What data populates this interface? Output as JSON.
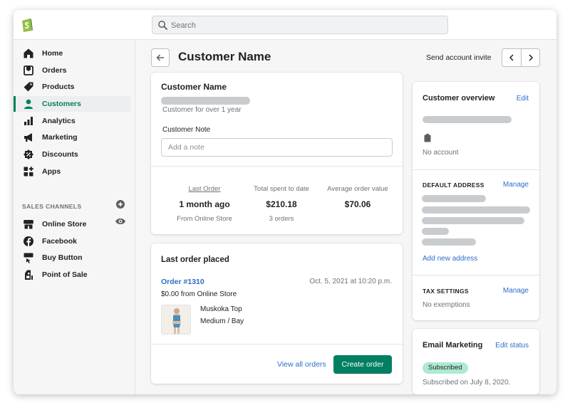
{
  "search": {
    "placeholder": "Search"
  },
  "nav": {
    "items": [
      {
        "label": "Home",
        "icon": "home-icon"
      },
      {
        "label": "Orders",
        "icon": "orders-icon"
      },
      {
        "label": "Products",
        "icon": "tag-icon"
      },
      {
        "label": "Customers",
        "icon": "person-icon",
        "active": true
      },
      {
        "label": "Analytics",
        "icon": "bar-chart-icon"
      },
      {
        "label": "Marketing",
        "icon": "megaphone-icon"
      },
      {
        "label": "Discounts",
        "icon": "discount-icon"
      },
      {
        "label": "Apps",
        "icon": "apps-icon"
      }
    ],
    "sales_channels_label": "SALES CHANNELS",
    "channels": [
      {
        "label": "Online Store",
        "icon": "store-icon"
      },
      {
        "label": "Facebook",
        "icon": "facebook-icon"
      },
      {
        "label": "Buy Button",
        "icon": "buy-button-icon"
      },
      {
        "label": "Point of Sale",
        "icon": "point-of-sale-icon"
      }
    ]
  },
  "page": {
    "title": "Customer Name",
    "send_invite": "Send account invite"
  },
  "customer_card": {
    "title": "Customer Name",
    "since": "Customer for over 1 year",
    "note_label": "Customer Note",
    "note_placeholder": "Add a note",
    "stats": {
      "last_order_label": "Last Order",
      "last_order_value": "1 month ago",
      "last_order_sub": "From Online Store",
      "total_spent_label": "Total spent to date",
      "total_spent_value": "$210.18",
      "total_spent_sub": "3 orders",
      "avg_order_label": "Average order value",
      "avg_order_value": "$70.06"
    }
  },
  "last_order": {
    "title": "Last order placed",
    "order_number": "Order #1310",
    "date": "Oct. 5, 2021 at 10:20 p.m.",
    "amount_source": "$0.00 from Online Store",
    "product_name": "Muskoka Top",
    "product_variant": "Medium / Bay",
    "view_all": "View all orders",
    "create_order": "Create order"
  },
  "overview": {
    "title": "Customer overview",
    "edit": "Edit",
    "no_account": "No account",
    "default_address_label": "DEFAULT ADDRESS",
    "manage": "Manage",
    "add_address": "Add new address",
    "tax_label": "TAX SETTINGS",
    "tax_manage": "Manage",
    "tax_value": "No exemptions"
  },
  "email_marketing": {
    "title": "Email Marketing",
    "edit_status": "Edit status",
    "badge": "Subscribed",
    "subscribed_on": "Subscribed on July 8, 2020."
  },
  "colors": {
    "accent": "#008060",
    "link": "#2c6ecb",
    "badge": "#aee9d1"
  }
}
